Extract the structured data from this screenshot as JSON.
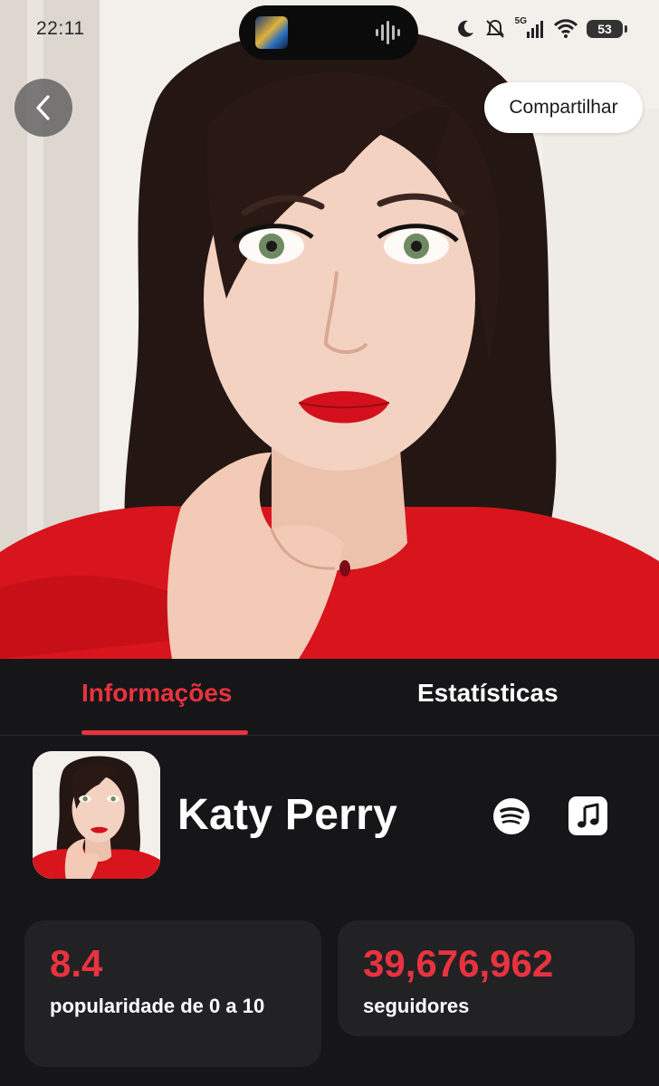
{
  "status_bar": {
    "time": "22:11",
    "network": "5G",
    "battery": "53",
    "icons": [
      "moon-icon",
      "silent-icon",
      "signal-icon",
      "wifi-icon",
      "battery-icon"
    ]
  },
  "header": {
    "back_icon": "chevron-left-icon",
    "share_label": "Compartilhar"
  },
  "tabs": [
    {
      "label": "Informações",
      "active": true
    },
    {
      "label": "Estatísticas",
      "active": false
    }
  ],
  "artist": {
    "name": "Katy Perry",
    "links": [
      "spotify-icon",
      "apple-music-icon"
    ]
  },
  "stats": {
    "popularity": {
      "value": "8.4",
      "label": "popularidade de 0 a 10"
    },
    "followers": {
      "value": "39,676,962",
      "label": "seguidores"
    }
  },
  "colors": {
    "accent": "#e8333f",
    "background": "#161517",
    "card": "#222124"
  }
}
